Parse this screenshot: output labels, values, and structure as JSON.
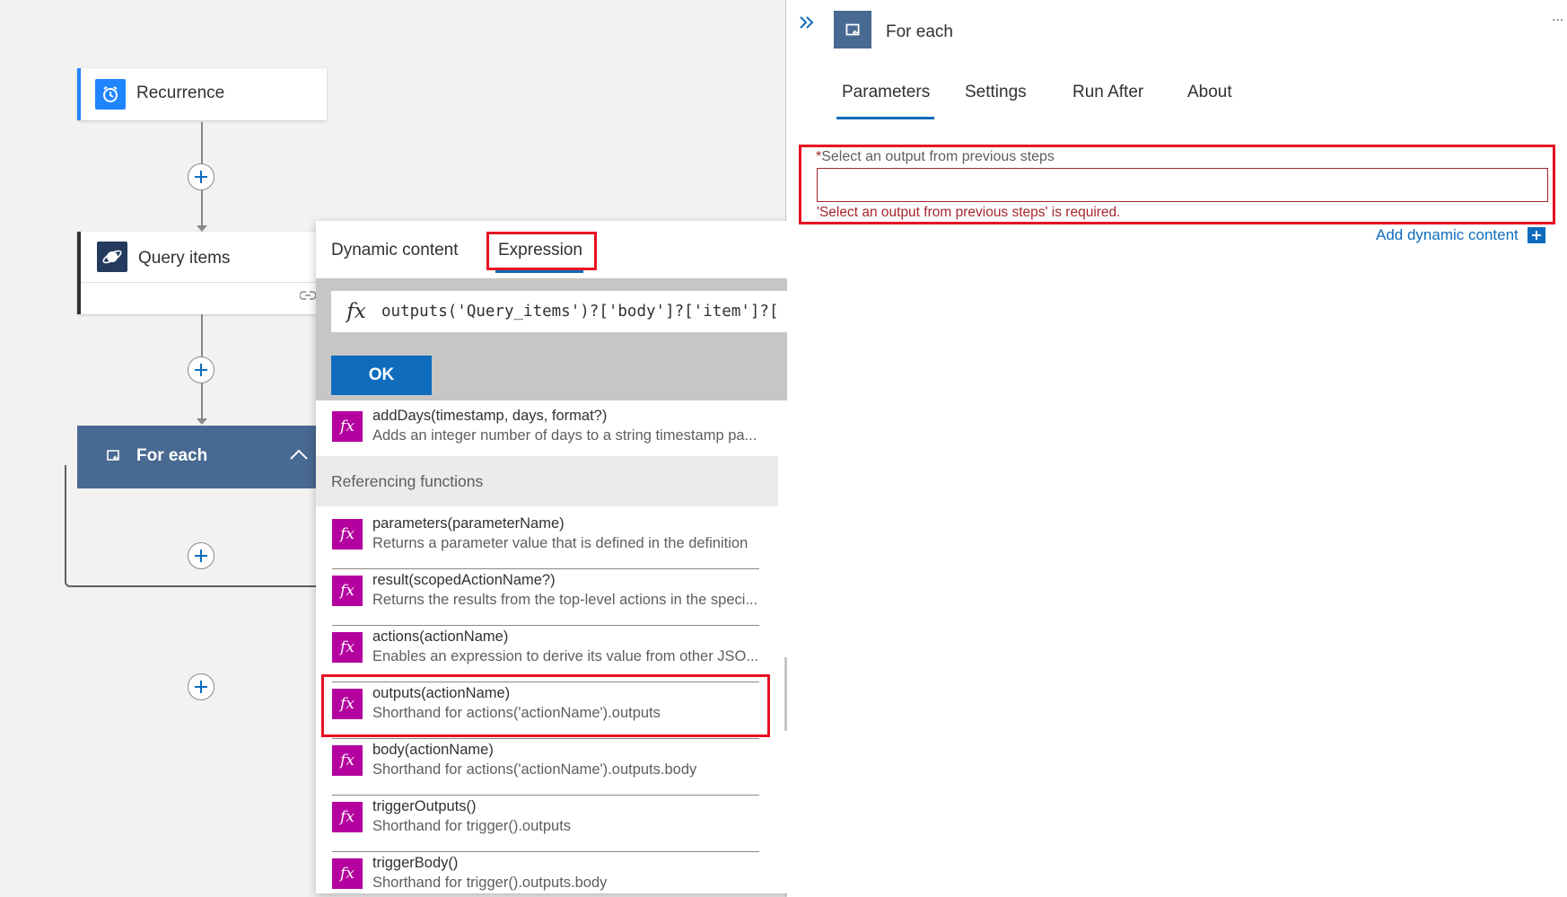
{
  "canvas": {
    "recurrence": {
      "title": "Recurrence",
      "icon": "alarm-clock-icon",
      "accent": "#1f85ff"
    },
    "query_items": {
      "title": "Query items",
      "icon": "cosmos-db-icon"
    },
    "for_each": {
      "title": "For each",
      "icon": "loop-icon",
      "color": "#486991"
    }
  },
  "popup": {
    "tabs": [
      "Dynamic content",
      "Expression"
    ],
    "active_tab": "Expression",
    "expression_value": "outputs('Query_items')?['body']?['item']?[",
    "ok_label": "OK",
    "section_header": "Referencing functions",
    "top_function": {
      "signature": "addDays(timestamp, days, format?)",
      "description": "Adds an integer number of days to a string timestamp pa..."
    },
    "functions": [
      {
        "signature": "parameters(parameterName)",
        "description": "Returns a parameter value that is defined in the definition"
      },
      {
        "signature": "result(scopedActionName?)",
        "description": "Returns the results from the top-level actions in the speci..."
      },
      {
        "signature": "actions(actionName)",
        "description": "Enables an expression to derive its value from other JSO..."
      },
      {
        "signature": "outputs(actionName)",
        "description": "Shorthand for actions('actionName').outputs"
      },
      {
        "signature": "body(actionName)",
        "description": "Shorthand for actions('actionName').outputs.body"
      },
      {
        "signature": "triggerOutputs()",
        "description": "Shorthand for trigger().outputs"
      },
      {
        "signature": "triggerBody()",
        "description": "Shorthand for trigger().outputs.body"
      }
    ]
  },
  "panel": {
    "title": "For each",
    "tabs": [
      "Parameters",
      "Settings",
      "Run After",
      "About"
    ],
    "active_tab": "Parameters",
    "field_label": "Select an output from previous steps",
    "required_marker": "*",
    "field_value": "",
    "error_text": "'Select an output from previous steps' is required.",
    "add_dynamic_label": "Add dynamic content",
    "more_label": "..."
  },
  "colors": {
    "accent_blue": "#0f6cbd",
    "error_red": "#e81123",
    "fx_purple": "#b4009e",
    "error_text": "#a4262c"
  }
}
